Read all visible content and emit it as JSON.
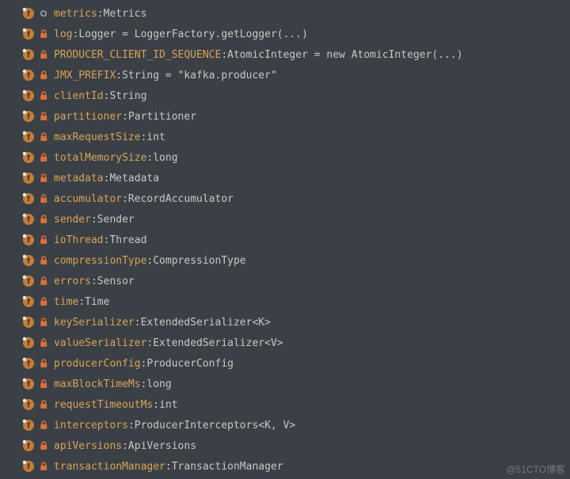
{
  "watermark": "@51CTO博客",
  "fields": [
    {
      "name": "metrics",
      "type": "Metrics",
      "modifier": "package"
    },
    {
      "name": "log",
      "type": "Logger = LoggerFactory.getLogger(...)",
      "modifier": "private"
    },
    {
      "name": "PRODUCER_CLIENT_ID_SEQUENCE",
      "type": "AtomicInteger = new AtomicInteger(...)",
      "modifier": "private"
    },
    {
      "name": "JMX_PREFIX",
      "type": "String = \"kafka.producer\"",
      "modifier": "private"
    },
    {
      "name": "clientId",
      "type": "String",
      "modifier": "private"
    },
    {
      "name": "partitioner",
      "type": "Partitioner",
      "modifier": "private"
    },
    {
      "name": "maxRequestSize",
      "type": "int",
      "modifier": "private"
    },
    {
      "name": "totalMemorySize",
      "type": "long",
      "modifier": "private"
    },
    {
      "name": "metadata",
      "type": "Metadata",
      "modifier": "private"
    },
    {
      "name": "accumulator",
      "type": "RecordAccumulator",
      "modifier": "private"
    },
    {
      "name": "sender",
      "type": "Sender",
      "modifier": "private"
    },
    {
      "name": "ioThread",
      "type": "Thread",
      "modifier": "private"
    },
    {
      "name": "compressionType",
      "type": "CompressionType",
      "modifier": "private"
    },
    {
      "name": "errors",
      "type": "Sensor",
      "modifier": "private"
    },
    {
      "name": "time",
      "type": "Time",
      "modifier": "private"
    },
    {
      "name": "keySerializer",
      "type": "ExtendedSerializer<K>",
      "modifier": "private"
    },
    {
      "name": "valueSerializer",
      "type": "ExtendedSerializer<V>",
      "modifier": "private"
    },
    {
      "name": "producerConfig",
      "type": "ProducerConfig",
      "modifier": "private"
    },
    {
      "name": "maxBlockTimeMs",
      "type": "long",
      "modifier": "private"
    },
    {
      "name": "requestTimeoutMs",
      "type": "int",
      "modifier": "private"
    },
    {
      "name": "interceptors",
      "type": "ProducerInterceptors<K, V>",
      "modifier": "private"
    },
    {
      "name": "apiVersions",
      "type": "ApiVersions",
      "modifier": "private"
    },
    {
      "name": "transactionManager",
      "type": "TransactionManager",
      "modifier": "private"
    }
  ]
}
